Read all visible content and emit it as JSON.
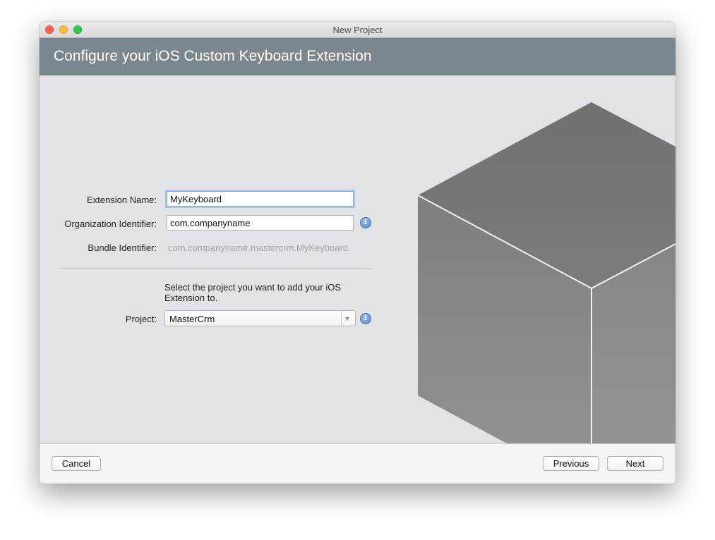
{
  "window": {
    "title": "New Project"
  },
  "header": {
    "title": "Configure your iOS Custom Keyboard Extension"
  },
  "form": {
    "extension_name": {
      "label": "Extension Name:",
      "value": "MyKeyboard"
    },
    "organization_identifier": {
      "label": "Organization Identifier:",
      "value": "com.companyname"
    },
    "bundle_identifier": {
      "label": "Bundle Identifier:",
      "value": "com.companyname.mastercrm.MyKeyboard"
    },
    "project_hint": "Select the project you want to add your iOS Extension to.",
    "project": {
      "label": "Project:",
      "selected": "MasterCrm"
    },
    "info_glyph": "i"
  },
  "footer": {
    "cancel_label": "Cancel",
    "previous_label": "Previous",
    "next_label": "Next"
  },
  "icons": {
    "info": "info-icon",
    "dropdown": "chevron-down-icon",
    "illustration": "cube-illustration"
  },
  "colors": {
    "header_band": "#7a8791",
    "content_bg": "#e1e3e7",
    "cube_top": "#757677",
    "cube_side": "#8a8b8d",
    "focus_ring": "#a9c8ee"
  }
}
